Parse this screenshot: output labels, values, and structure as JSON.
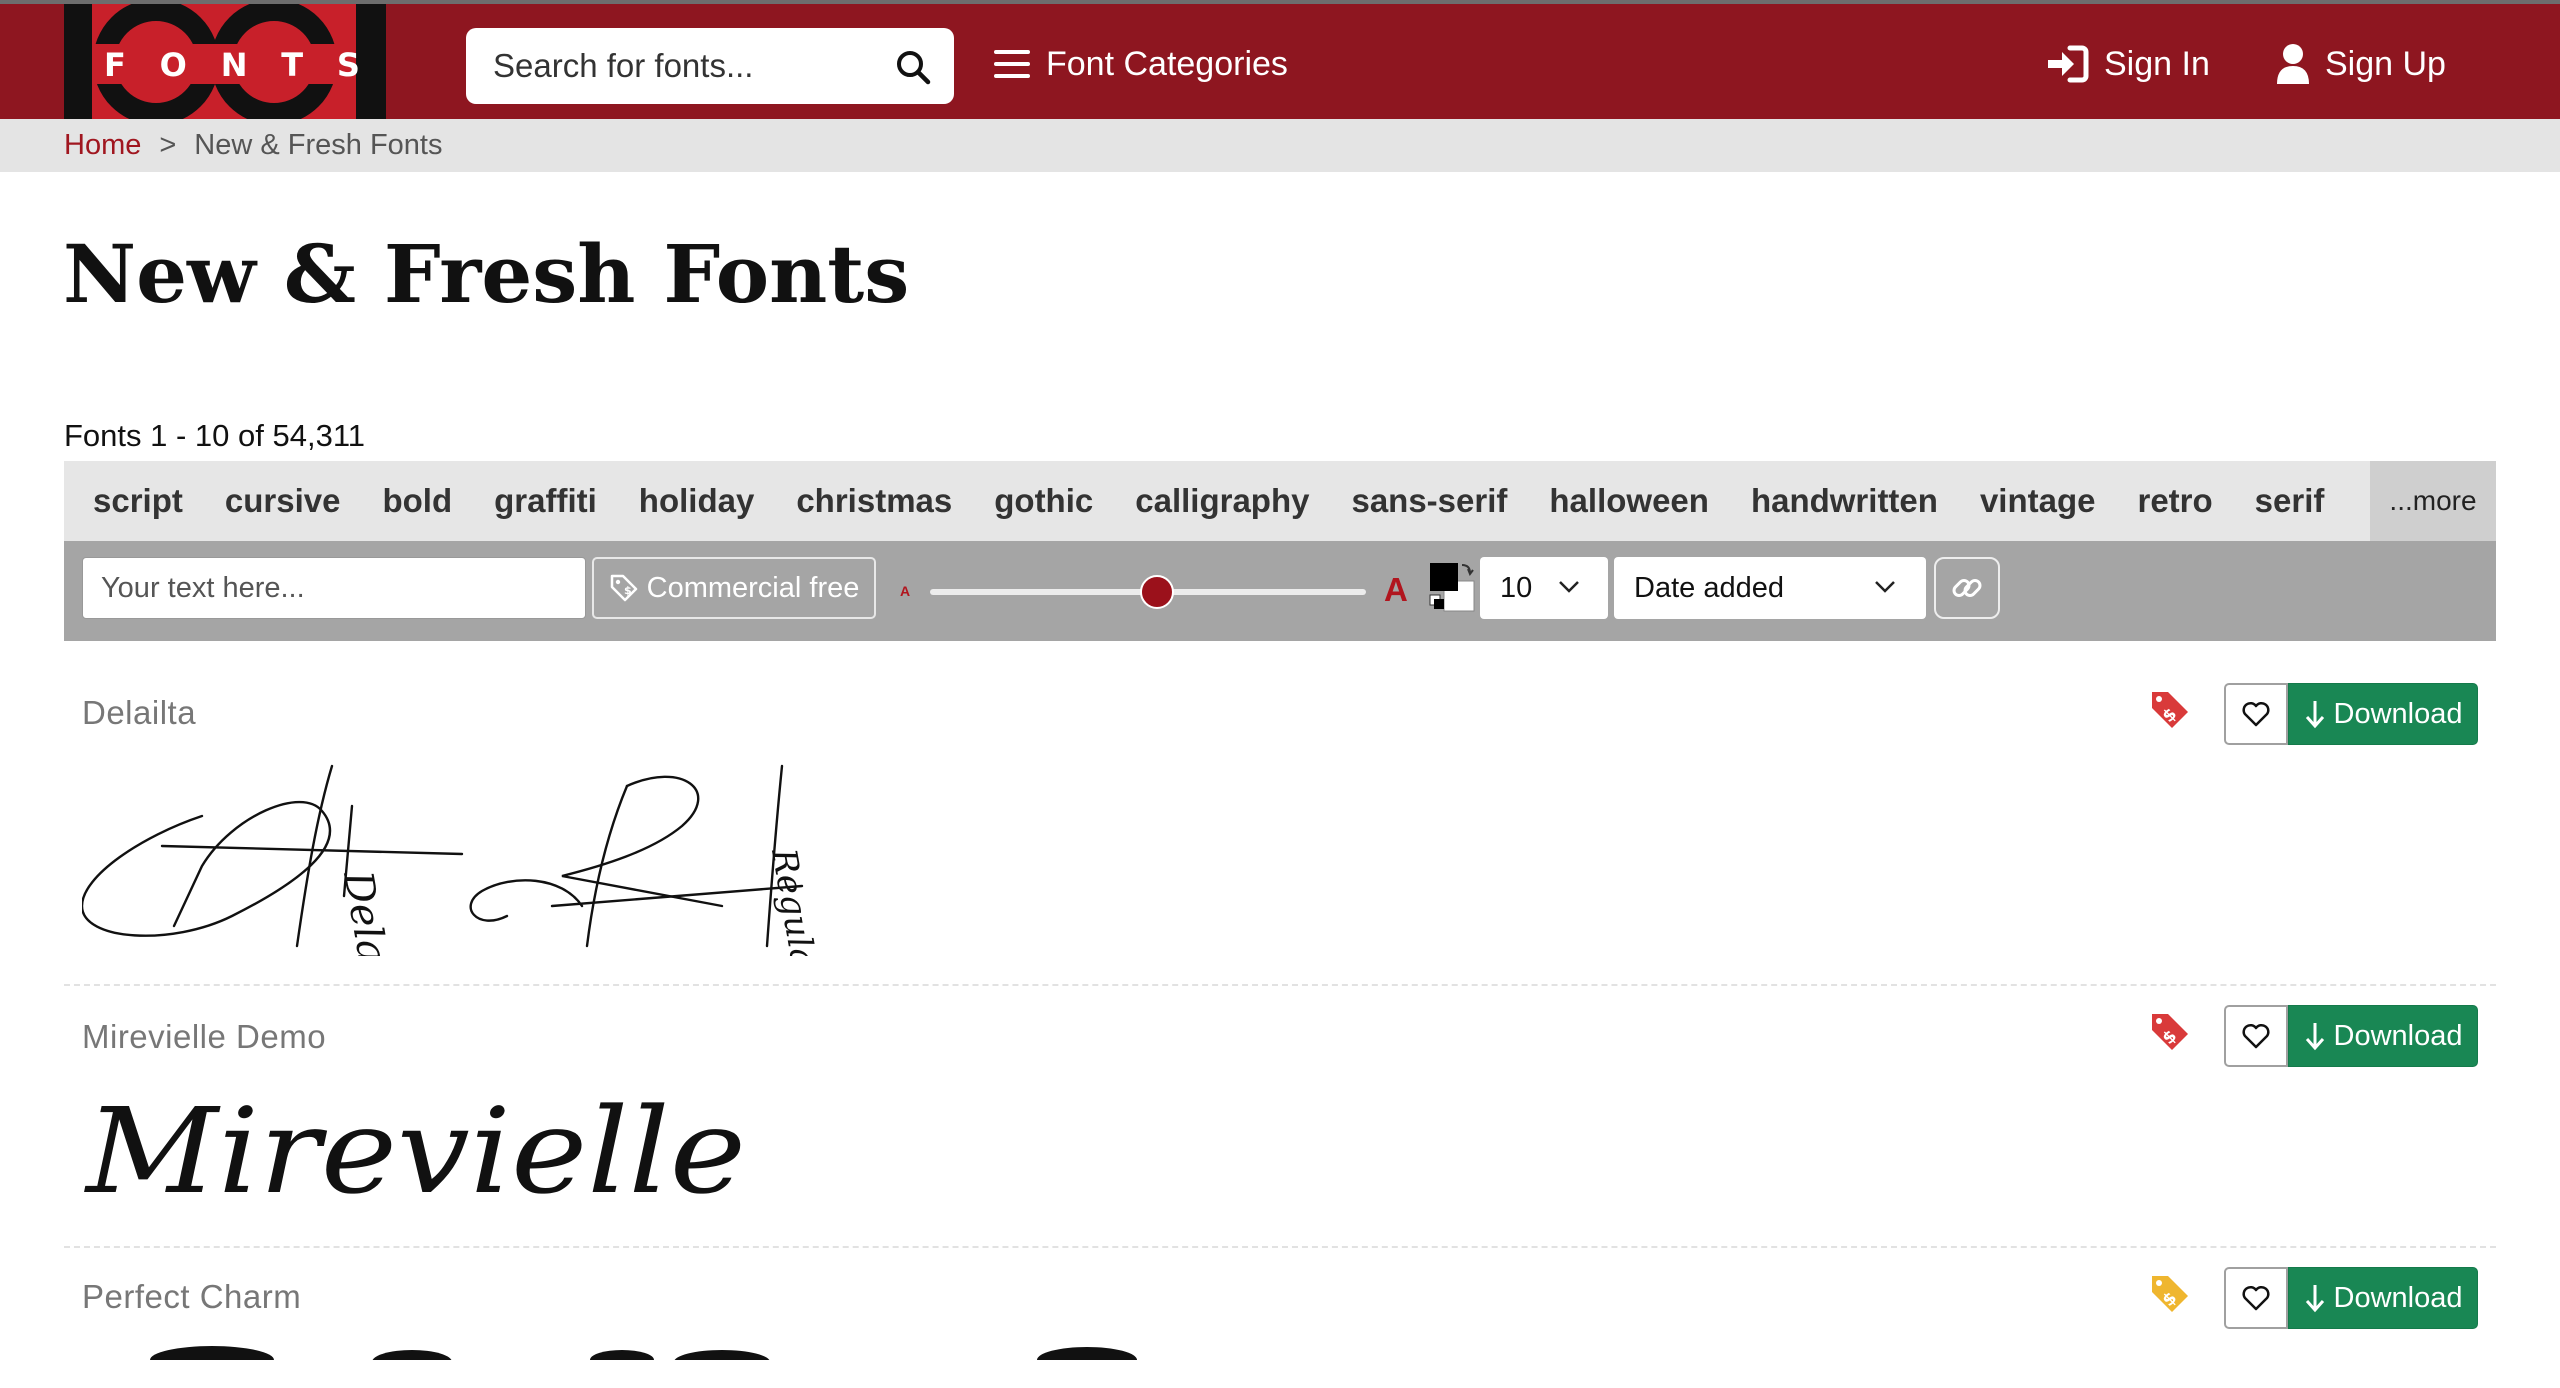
{
  "header": {
    "logo_number": "1001",
    "logo_letters": [
      "F",
      "O",
      "N",
      "T",
      "S"
    ],
    "search_placeholder": "Search for fonts...",
    "categories_label": "Font Categories",
    "signin_label": "Sign In",
    "signup_label": "Sign Up",
    "brand_color": "#8e1620"
  },
  "breadcrumb": {
    "home": "Home",
    "separator": ">",
    "current": "New & Fresh Fonts"
  },
  "page": {
    "title": "New & Fresh Fonts",
    "count_text": "Fonts 1 - 10 of 54,311"
  },
  "tags": {
    "items": [
      "script",
      "cursive",
      "bold",
      "graffiti",
      "holiday",
      "christmas",
      "gothic",
      "calligraphy",
      "sans-serif",
      "halloween",
      "handwritten",
      "vintage",
      "retro",
      "serif"
    ],
    "more_label": "...more"
  },
  "controls": {
    "text_placeholder": "Your text here...",
    "commercial_label": "Commercial free",
    "size_small_glyph": "A",
    "size_large_glyph": "A",
    "size_level_fraction": 0.52,
    "per_page_value": "10",
    "sort_value": "Date added"
  },
  "fonts": [
    {
      "name": "Delailta",
      "preview_line1": "Delailta",
      "preview_line2": "Regular",
      "license_tag_color": "#d93a3a",
      "download_label": "Download"
    },
    {
      "name": "Mirevielle Demo",
      "preview_text": "Mirevielle",
      "license_tag_color": "#d93a3a",
      "download_label": "Download"
    },
    {
      "name": "Perfect Charm",
      "license_tag_color": "#efb62f",
      "download_label": "Download"
    }
  ]
}
